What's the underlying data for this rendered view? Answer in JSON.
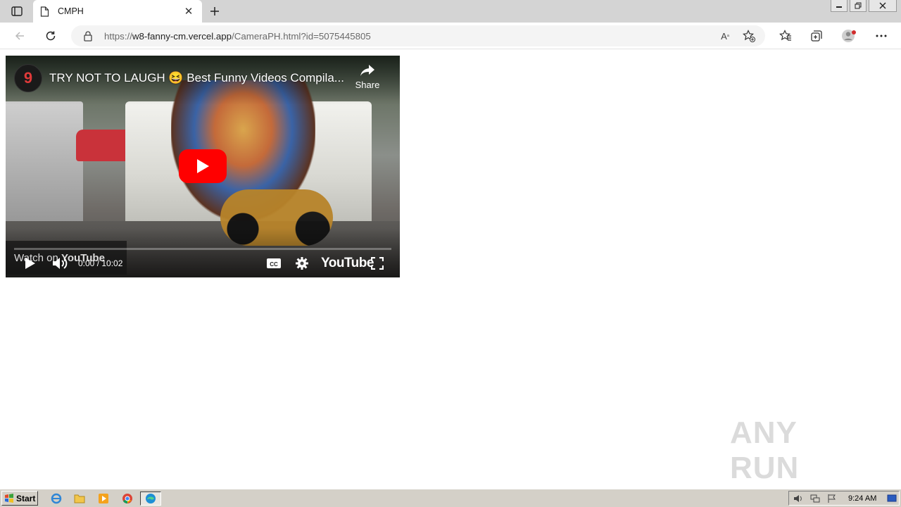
{
  "browser": {
    "tab": {
      "title": "CMPH"
    },
    "address": {
      "prefix": "https://",
      "domain": "w8-fanny-cm.vercel.app",
      "path": "/CameraPH.html?id=5075445805"
    }
  },
  "video": {
    "channel_badge": "9",
    "title": "TRY NOT TO LAUGH 😆 Best Funny Videos Compila...",
    "share_label": "Share",
    "watch_on_label": "Watch on",
    "watch_on_brand": "YouTube",
    "time": "0:00 / 10:02",
    "brand": "YouTube"
  },
  "watermark": {
    "text": "ANY RUN"
  },
  "taskbar": {
    "start_label": "Start",
    "clock": "9:24 AM"
  },
  "icons": {
    "lock": "lock-icon",
    "refresh": "refresh-icon",
    "back": "back-arrow-icon",
    "favorites": "favorites-icon",
    "collections": "collections-icon",
    "profile": "profile-icon",
    "more": "more-icon"
  }
}
